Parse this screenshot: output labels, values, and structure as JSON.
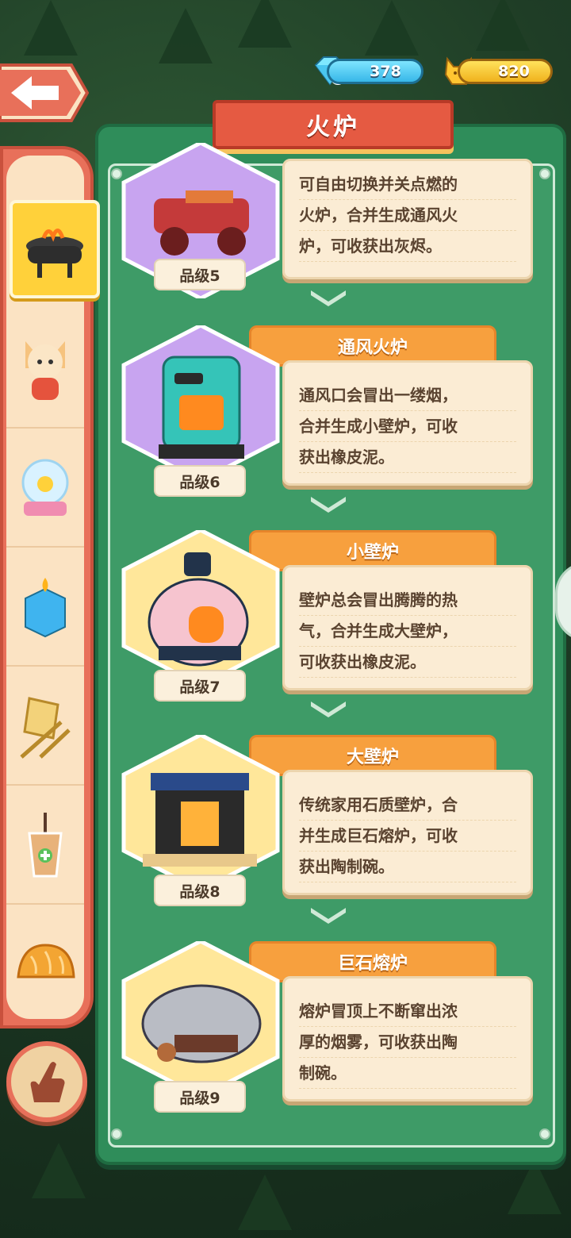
{
  "header": {
    "title": "火炉",
    "gems": "378",
    "gold": "820"
  },
  "sidebar": {
    "items": [
      {
        "icon": "grill-icon",
        "selected": true
      },
      {
        "icon": "cat-plush-icon"
      },
      {
        "icon": "snow-globe-icon"
      },
      {
        "icon": "ice-cube-candle-icon"
      },
      {
        "icon": "folding-chair-icon"
      },
      {
        "icon": "bubble-tea-icon"
      },
      {
        "icon": "bread-icon"
      }
    ],
    "hand_icon": "hand-pointer-icon"
  },
  "items": [
    {
      "name": "",
      "level": "品级5",
      "desc": [
        "可自由切换并关点燃的",
        "火炉，合并生成通风火",
        "炉，可收获出灰烬。"
      ],
      "icon": "bbq-cart-icon"
    },
    {
      "name": "通风火炉",
      "level": "品级6",
      "desc": [
        "通风口会冒出一缕烟，",
        "合并生成小壁炉，可收",
        "获出橡皮泥。"
      ],
      "icon": "vent-stove-icon"
    },
    {
      "name": "小壁炉",
      "level": "品级7",
      "desc": [
        "壁炉总会冒出腾腾的热",
        "气，合并生成大壁炉，",
        "可收获出橡皮泥。"
      ],
      "icon": "small-fireplace-icon"
    },
    {
      "name": "大壁炉",
      "level": "品级8",
      "desc": [
        "传统家用石质壁炉，合",
        "并生成巨石熔炉，可收",
        "获出陶制碗。"
      ],
      "icon": "large-fireplace-icon"
    },
    {
      "name": "巨石熔炉",
      "level": "品级9",
      "desc": [
        "熔炉冒顶上不断窜出浓",
        "厚的烟雾，可收获出陶",
        "制碗。"
      ],
      "icon": "stone-furnace-icon"
    }
  ],
  "colors": {
    "panel_green": "#2f8d5a",
    "ribbon_red": "#e55a42",
    "tab_orange": "#f7a03e",
    "card_cream": "#fbecd4"
  }
}
